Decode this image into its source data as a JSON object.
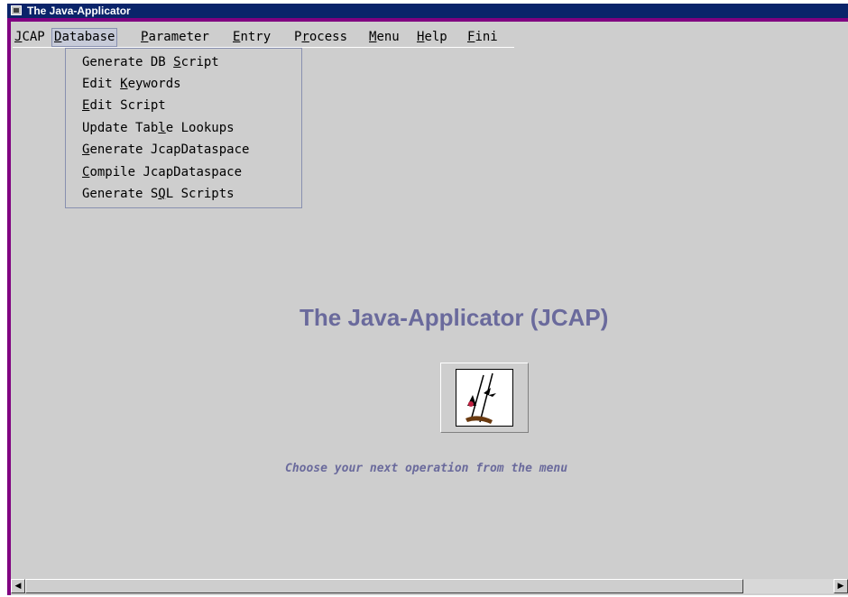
{
  "window": {
    "title": "The Java-Applicator"
  },
  "menubar": {
    "items": [
      {
        "pre": "",
        "u": "J",
        "post": "CAP"
      },
      {
        "pre": "",
        "u": "D",
        "post": "atabase"
      },
      {
        "pre": "",
        "u": "P",
        "post": "arameter"
      },
      {
        "pre": "",
        "u": "E",
        "post": "ntry"
      },
      {
        "pre": "P",
        "u": "r",
        "post": "ocess"
      },
      {
        "pre": "",
        "u": "M",
        "post": "enu"
      },
      {
        "pre": "",
        "u": "H",
        "post": "elp"
      },
      {
        "pre": "",
        "u": "F",
        "post": "ini"
      }
    ],
    "active": "Database"
  },
  "dropdown": {
    "items": [
      {
        "pre": "Generate DB ",
        "u": "S",
        "post": "cript"
      },
      {
        "pre": "Edit ",
        "u": "K",
        "post": "eywords"
      },
      {
        "pre": "",
        "u": "E",
        "post": "dit Script"
      },
      {
        "pre": "Update Tab",
        "u": "l",
        "post": "e Lookups"
      },
      {
        "pre": "",
        "u": "G",
        "post": "enerate JcapDataspace"
      },
      {
        "pre": "",
        "u": "C",
        "post": "ompile JcapDataspace"
      },
      {
        "pre": "Generate S",
        "u": "Q",
        "post": "L Scripts"
      }
    ]
  },
  "main": {
    "heading": "The Java-Applicator (JCAP)",
    "subtitle": "Choose your next operation from the menu"
  },
  "scrollbar": {
    "left_arrow": "◀",
    "right_arrow": "▶"
  },
  "colors": {
    "title_bar": "#0a246a",
    "window_frame": "#800080",
    "client_background": "#cecece",
    "heading_text": "#6a6a9c"
  }
}
